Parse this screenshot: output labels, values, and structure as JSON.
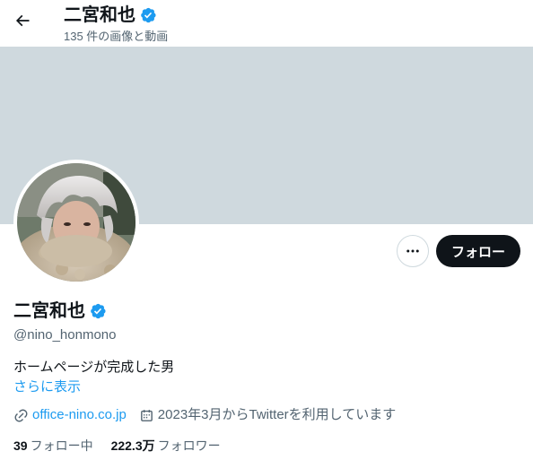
{
  "header": {
    "title": "二宮和也",
    "subtitle": "135 件の画像と動画"
  },
  "profile": {
    "display_name": "二宮和也",
    "handle": "@nino_honmono",
    "bio": "ホームページが完成した男",
    "show_more": "さらに表示",
    "website": "office-nino.co.jp",
    "joined": "2023年3月からTwitterを利用しています",
    "following_count": "39",
    "following_label": "フォロー中",
    "followers_count": "222.3万",
    "followers_label": "フォロワー"
  },
  "actions": {
    "follow_label": "フォロー"
  },
  "colors": {
    "accent": "#1d9bf0",
    "banner": "#cfd9de",
    "follow_button": "#0f1419",
    "secondary_text": "#536471"
  },
  "icons": {
    "back": "back-arrow-icon",
    "verified": "verified-badge-icon",
    "more": "more-options-icon",
    "link": "link-icon",
    "calendar": "calendar-icon"
  }
}
